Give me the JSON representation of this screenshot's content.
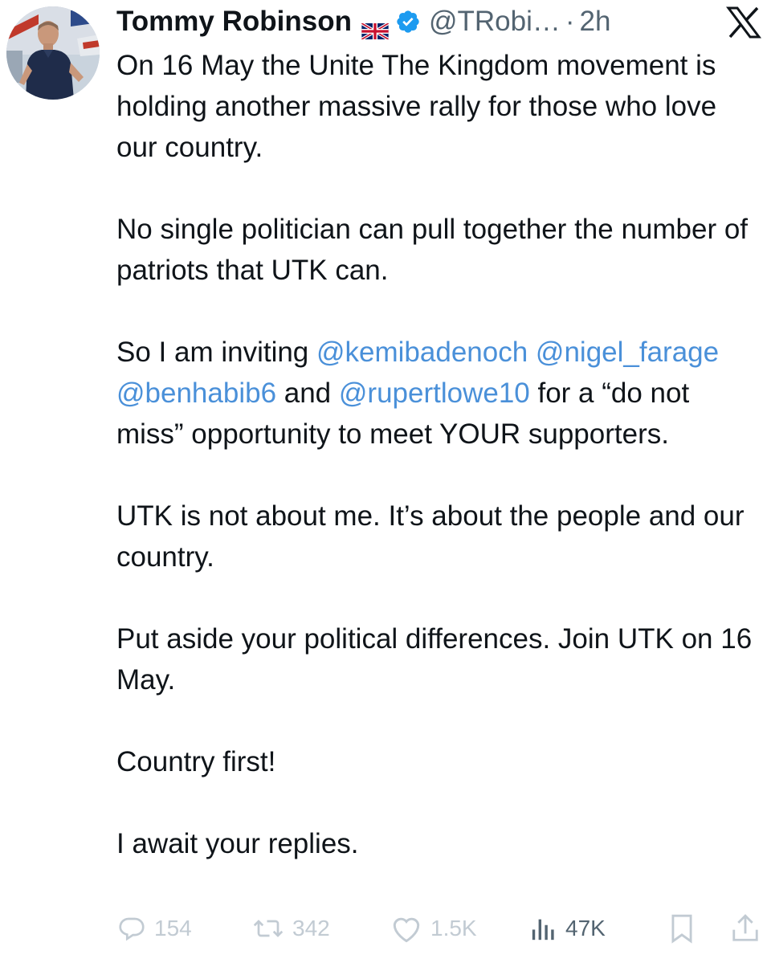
{
  "tweet": {
    "author_name": "Tommy Robinson",
    "flag_icon": "uk-flag-icon",
    "verified_icon": "verified-badge-icon",
    "handle": "@TRobi…",
    "separator": "·",
    "time": "2h",
    "platform_icon": "x-logo-icon",
    "paragraphs": [
      {
        "parts": [
          {
            "text": "On 16 May the Unite The Kingdom movement is holding another massive rally for those who love our country."
          }
        ]
      },
      {
        "parts": [
          {
            "text": "No single politician can pull together the number of patriots that UTK can."
          }
        ]
      },
      {
        "parts": [
          {
            "text": "So I am inviting "
          },
          {
            "text": "@kemibadenoch",
            "mention": true
          },
          {
            "text": " "
          },
          {
            "text": "@nigel_farage",
            "mention": true
          },
          {
            "text": " "
          },
          {
            "text": "@benhabib6",
            "mention": true
          },
          {
            "text": " and "
          },
          {
            "text": "@rupertlowe10",
            "mention": true
          },
          {
            "text": " for a “do not miss” opportunity to meet YOUR supporters."
          }
        ]
      },
      {
        "parts": [
          {
            "text": "UTK is not about me. It’s about the people and our country."
          }
        ]
      },
      {
        "parts": [
          {
            "text": "Put aside your political  differences. Join UTK on 16 May."
          }
        ]
      },
      {
        "parts": [
          {
            "text": "Country first!"
          }
        ]
      },
      {
        "parts": [
          {
            "text": "I await your replies."
          }
        ]
      }
    ]
  },
  "actions": {
    "replies": {
      "icon": "reply-icon",
      "count": "154"
    },
    "reposts": {
      "icon": "repost-icon",
      "count": "342"
    },
    "likes": {
      "icon": "heart-icon",
      "count": "1.5K"
    },
    "views": {
      "icon": "views-icon",
      "count": "47K"
    },
    "bookmark": {
      "icon": "bookmark-icon"
    },
    "share": {
      "icon": "share-icon"
    }
  },
  "colors": {
    "mention": "#4a90d9",
    "verified": "#1d9bf0",
    "text": "#0f1419",
    "secondary": "#536471",
    "faded_icon": "#c2cbd3"
  }
}
